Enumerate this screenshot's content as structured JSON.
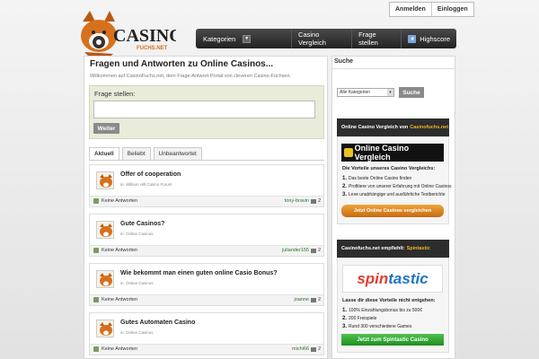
{
  "header": {
    "logo_text": "CASINO",
    "logo_sub": "FUCHS.NET",
    "auth": {
      "login": "Anmelden",
      "register": "Einloggen"
    },
    "nav": {
      "category": "Kategorien",
      "links": [
        "Casino Vergleich",
        "Frage stellen",
        "Highscore"
      ]
    }
  },
  "main": {
    "title": "Fragen und Antworten zu Online Casinos...",
    "subtitle": "Willkommen auf CasinoFuchs.net, dem Frage-Antwort-Portal von cleveren Casino-Füchsen.",
    "ask_label": "Frage stellen:",
    "ask_button": "Weiter",
    "tabs": [
      "Aktuell",
      "Beliebt",
      "Unbeantwortet"
    ],
    "questions": [
      {
        "title": "Offer of cooperation",
        "category": "in: William Hill Casino Forum",
        "answers": "Keine Antworten",
        "user": "tony-bravin",
        "count": "2"
      },
      {
        "title": "Gute Casinos?",
        "category": "in: Online Casinos",
        "answers": "Keine Antworten",
        "user": "juliander155",
        "count": "2"
      },
      {
        "title": "Wie bekommt man einen guten online Casio Bonus?",
        "category": "in: Online Casinos",
        "answers": "Keine Antworten",
        "user": "joanne",
        "count": "2"
      },
      {
        "title": "Gutes Automaten Casino",
        "category": "in: Online Casinos",
        "answers": "Keine Antworten",
        "user": "michi66",
        "count": "2"
      }
    ]
  },
  "sidebar": {
    "search_heading": "Suche",
    "category_select": "Alle Kategorien",
    "search_button": "Suche",
    "promo1": {
      "head": "Online Casino Vergleich von",
      "head_hl": "Casinofuchs.net",
      "banner": "Online Casino Vergleich",
      "intro": "Die Vorteile unseres Casino Vergleichs:",
      "items": [
        "Das beste Online Casino finden",
        "Profitiere von unserer Erfahrung mit Online Casinos",
        "Lese unabhängige und ausführliche Testberichte"
      ],
      "button": "Jetzt Online Casinos vergleichen"
    },
    "promo2": {
      "head": "Casinofuchs.net empfiehlt:",
      "head_hl": "Spintastic",
      "brand_a": "spin",
      "brand_b": "tastic",
      "intro": "Lasse dir diese Vorteile nicht entgehen:",
      "items": [
        "100% Einzahlungsbonus bis zu 500€",
        "200 Freispiele",
        "Rund 300 verschiedene Games"
      ],
      "button": "Jetzt zum Spintastic Casino"
    }
  },
  "colors": {
    "accent_orange": "#e07a17",
    "accent_green": "#2ea32e",
    "nav_dark": "#2b2b2b"
  }
}
